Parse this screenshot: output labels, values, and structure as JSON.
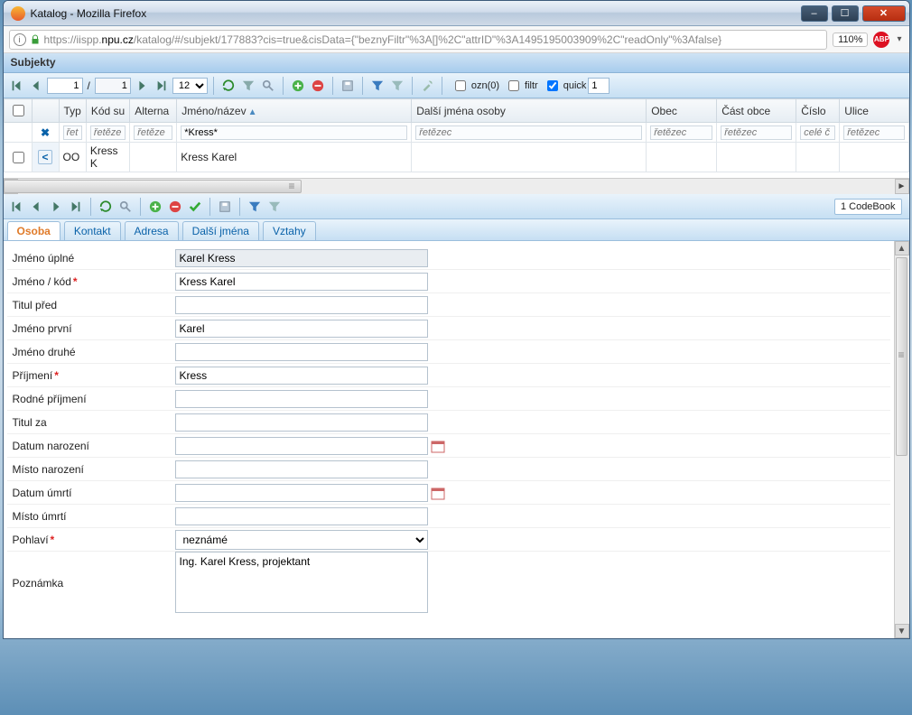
{
  "window": {
    "title": "Katalog - Mozilla Firefox"
  },
  "url": {
    "pre": "https://iispp.",
    "domain": "npu.cz",
    "post": "/katalog/#/subjekt/177883?cis=true&cisData={\"beznyFiltr\"%3A[]%2C\"attrID\"%3A1495195003909%2C\"readOnly\"%3Afalse}",
    "zoom": "110%"
  },
  "header": {
    "title": "Subjekty"
  },
  "toolbar": {
    "page": "1",
    "pages": "1",
    "pagesize": "12",
    "ozn": "ozn(0)",
    "filtr": "filtr",
    "quick": "quick",
    "quickval": "1"
  },
  "grid": {
    "headers": {
      "typ": "Typ",
      "kodsu": "Kód su",
      "alterna": "Alterna",
      "jmeno": "Jméno/název",
      "dalsi": "Další jména osoby",
      "obec": "Obec",
      "castobce": "Část obce",
      "cislo": "Číslo",
      "ulice": "Ulice"
    },
    "filters": {
      "typ_ph": "řet",
      "kodsu_ph": "řetěze",
      "alterna_ph": "řetěze",
      "jmeno_val": "*Kress*",
      "dalsi_ph": "řetězec",
      "obec_ph": "řetězec",
      "castobce_ph": "řetězec",
      "cislo_ph": "celé č",
      "ulice_ph": "řetězec"
    },
    "row": {
      "typ": "OO",
      "kodsu": "Kress K",
      "jmeno": "Kress Karel"
    }
  },
  "detail": {
    "codebook": "1 CodeBook"
  },
  "tabs": {
    "osoba": "Osoba",
    "kontakt": "Kontakt",
    "adresa": "Adresa",
    "dalsi": "Další jména",
    "vztahy": "Vztahy"
  },
  "form": {
    "labels": {
      "jmenouplne": "Jméno úplné",
      "jmenokod": "Jméno / kód",
      "titulpred": "Titul před",
      "jmenoprvni": "Jméno první",
      "jmenodruhe": "Jméno druhé",
      "prijmeni": "Příjmení",
      "rodne": "Rodné příjmení",
      "titulza": "Titul za",
      "datnar": "Datum narození",
      "mistnar": "Místo narození",
      "datumr": "Datum úmrtí",
      "mistumr": "Místo úmrtí",
      "pohlavi": "Pohlaví",
      "poznamka": "Poznámka"
    },
    "values": {
      "jmenouplne": "Karel Kress",
      "jmenokod": "Kress Karel",
      "titulpred": "",
      "jmenoprvni": "Karel",
      "jmenodruhe": "",
      "prijmeni": "Kress",
      "rodne": "",
      "titulza": "",
      "datnar": "",
      "mistnar": "",
      "datumr": "",
      "mistumr": "",
      "pohlavi": "neznámé",
      "poznamka": "Ing. Karel Kress, projektant"
    }
  }
}
